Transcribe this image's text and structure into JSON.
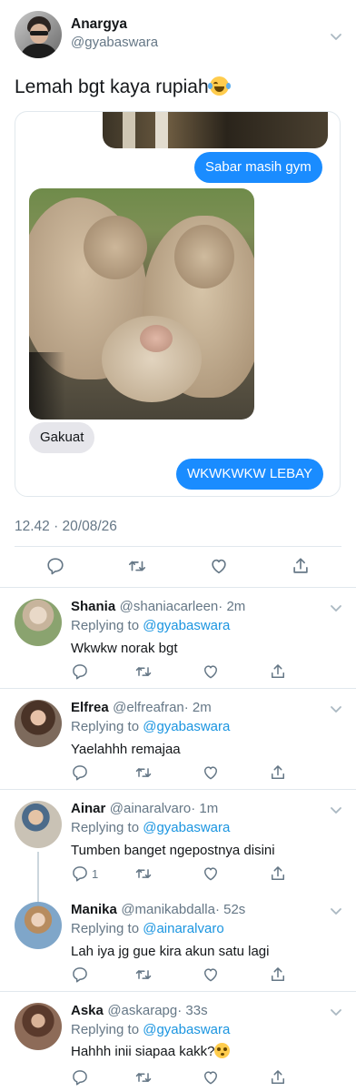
{
  "tweet": {
    "author_name": "Anargya",
    "author_handle": "@gyabaswara",
    "text": "Lemah bgt kaya rupiah",
    "emoji": "face-with-tears-of-joy-icon",
    "timestamp": "12.42 · 20/08/26",
    "chat": {
      "bubble_1": "Sabar masih gym",
      "bubble_2": "Gakuat",
      "bubble_3": "WKWKWKW LEBAY"
    }
  },
  "replies": [
    {
      "name": "Shania",
      "handle": "@shaniacarleen",
      "time": "· 2m",
      "replying_prefix": "Replying to",
      "replying_to": "@gyabaswara",
      "text": "Wkwkw norak bgt",
      "reply_count": ""
    },
    {
      "name": "Elfrea",
      "handle": "@elfreafran",
      "time": "· 2m",
      "replying_prefix": "Replying to",
      "replying_to": "@gyabaswara",
      "text": "Yaelahhh remajaa",
      "reply_count": ""
    },
    {
      "name": "Ainar",
      "handle": "@ainaralvaro",
      "time": "· 1m",
      "replying_prefix": "Replying to",
      "replying_to": "@gyabaswara",
      "text": "Tumben banget ngepostnya disini",
      "reply_count": "1"
    },
    {
      "name": "Manika",
      "handle": "@manikabdalla",
      "time": "· 52s",
      "replying_prefix": "Replying to",
      "replying_to": "@ainaralvaro",
      "text": "Lah iya jg gue kira akun satu lagi",
      "reply_count": ""
    },
    {
      "name": "Aska",
      "handle": "@askarapg",
      "time": "· 33s",
      "replying_prefix": "Replying to",
      "replying_to": "@gyabaswara",
      "text": "Hahhh inii siapaa kakk?",
      "reply_count": ""
    }
  ],
  "colors": {
    "link": "#1b95e0",
    "imessage_blue": "#1a8cff",
    "secondary_text": "#657786",
    "divider": "#e1e8ed"
  }
}
